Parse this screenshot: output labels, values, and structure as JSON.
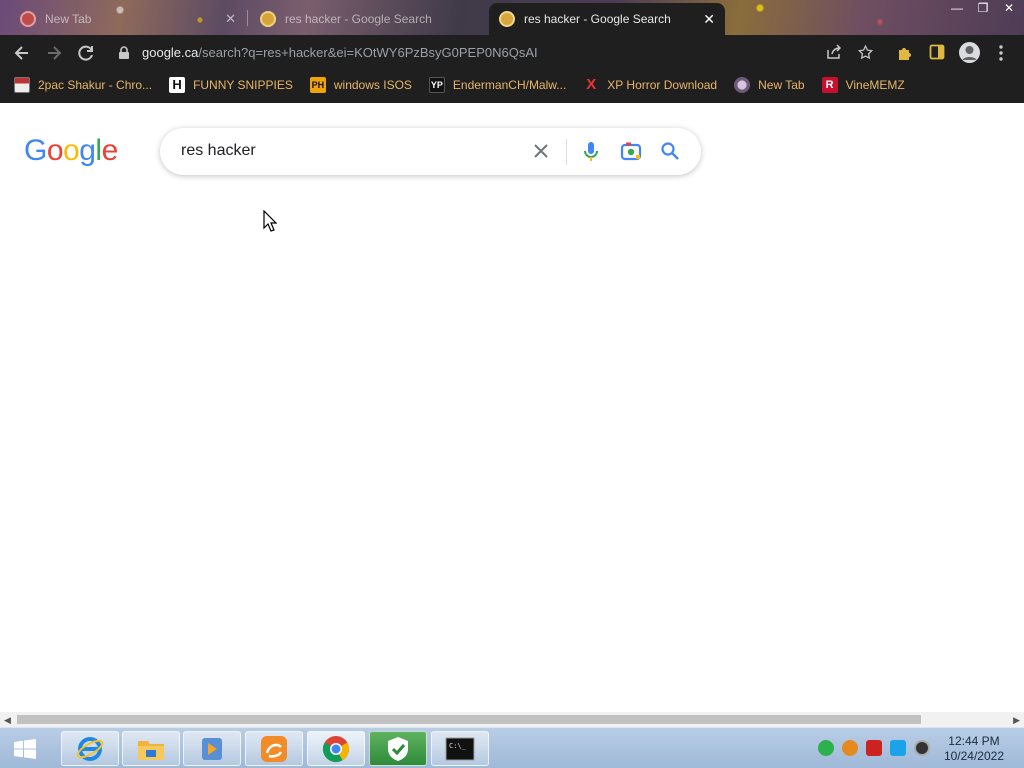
{
  "tabs": [
    {
      "title": "New Tab",
      "active": false
    },
    {
      "title": "res hacker - Google Search",
      "active": false
    },
    {
      "title": "res hacker - Google Search",
      "active": true
    }
  ],
  "window_controls": {
    "minimize": "—",
    "restore": "❐",
    "close": "✕"
  },
  "omnibox": {
    "host": "google.ca",
    "path": "/search?q=res+hacker&ei=KOtWY6PzBsyG0PEP0N6QsAI"
  },
  "bookmarks": [
    {
      "label": "2pac Shakur - Chro...",
      "icon": ""
    },
    {
      "label": "FUNNY SNIPPIES",
      "icon": "H"
    },
    {
      "label": "windows ISOS",
      "icon": "PH"
    },
    {
      "label": "EndermanCH/Malw...",
      "icon": "YP"
    },
    {
      "label": "XP Horror Download",
      "icon": "X"
    },
    {
      "label": "New Tab",
      "icon": ""
    },
    {
      "label": "VineMEMZ",
      "icon": "R"
    }
  ],
  "google": {
    "logo_letters": [
      "G",
      "o",
      "o",
      "g",
      "l",
      "e"
    ],
    "query": "res hacker"
  },
  "taskbar": {
    "apps": [
      "internet-explorer",
      "file-explorer",
      "media-player",
      "uc-browser",
      "chrome",
      "security-shield",
      "command-prompt"
    ],
    "clock_time": "12:44 PM",
    "clock_date": "10/24/2022"
  },
  "colors": {
    "chrome_dark": "#1f1f1f",
    "bookmark_text": "#e8b66a",
    "google_blue": "#4285f4",
    "google_red": "#ea4335",
    "google_yellow": "#fbbc05",
    "google_green": "#34a853"
  }
}
